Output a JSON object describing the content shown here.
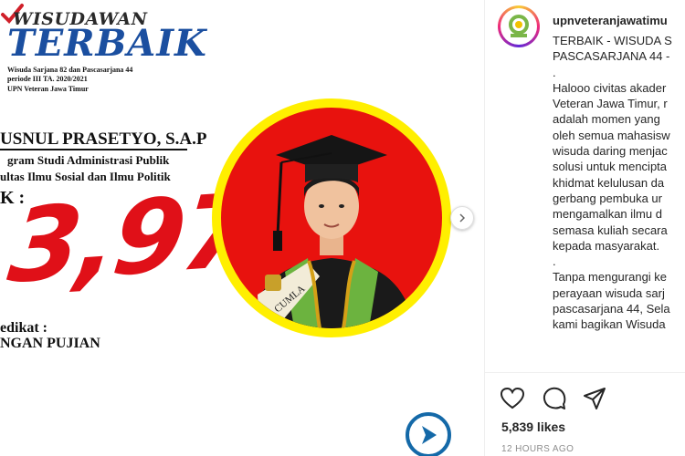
{
  "post_image": {
    "brand_top": "WISUDAWAN",
    "brand_main": "TERBAIK",
    "event_line1": "Wisuda Sarjana 82 dan Pascasarjana 44",
    "event_line2": "periode III TA. 2020/2021",
    "event_line3": "UPN Veteran Jawa Timur",
    "graduate_name": "USNUL PRASETYO, S.A.P",
    "program": "gram Studi Administrasi Publik",
    "faculty": "ultas Ilmu Sosial dan Ilmu Politik",
    "ipk_label": "K :",
    "ipk_value": "3,97",
    "predikat_label": "edikat :",
    "predikat_value": "NGAN PUJIAN",
    "sash_text": "CUMLA"
  },
  "account": {
    "username": "upnveteranjawatimu"
  },
  "caption": {
    "lines": [
      "TERBAIK - WISUDA S",
      "PASCASARJANA 44 -",
      ".",
      "Halooo civitas akader",
      "Veteran Jawa Timur, r",
      "adalah momen yang",
      "oleh semua mahasisw",
      "wisuda daring menjac",
      "solusi untuk mencipta",
      "khidmat kelulusan da",
      "gerbang pembuka ur",
      "mengamalkan ilmu d",
      "semasa kuliah secara",
      "kepada masyarakat.",
      ".",
      "Tanpa mengurangi ke",
      "perayaan wisuda sarj",
      "pascasarjana 44, Sela",
      "kami bagikan Wisuda"
    ]
  },
  "actions": {
    "like_icon": "heart-icon",
    "comment_icon": "comment-icon",
    "share_icon": "send-icon",
    "likes": "5,839 likes",
    "timestamp": "12 HOURS AGO"
  },
  "colors": {
    "accent_red": "#e8120e",
    "ring_yellow": "#ffef00",
    "brand_blue": "#1b4fa0",
    "nav_blue": "#1469a8"
  }
}
